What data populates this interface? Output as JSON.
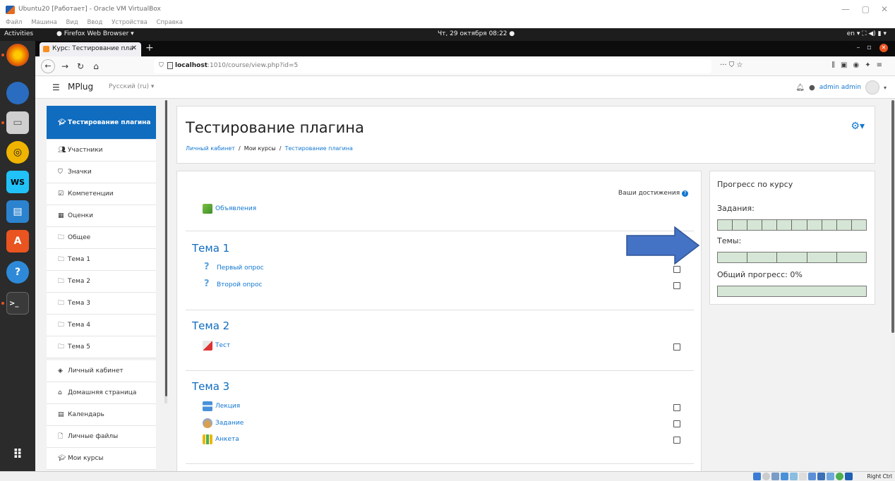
{
  "vbox": {
    "title": "Ubuntu20 [Работает] - Oracle VM VirtualBox",
    "menu": [
      "Файл",
      "Машина",
      "Вид",
      "Ввод",
      "Устройства",
      "Справка"
    ],
    "host_key": "Right Ctrl"
  },
  "gnome": {
    "activities": "Activities",
    "app": "Firefox Web Browser ▾",
    "clock": "Чт, 29 октября  08:22  ●",
    "tray": "en ▾   ⛶  ◀)  ▮ ▾"
  },
  "firefox": {
    "tab_title": "Курс: Тестирование пла",
    "url_host": "localhost",
    "url_path": ":1010/course/view.php?id=5"
  },
  "moodle": {
    "brand": "MPlug",
    "lang": "Русский (ru) ▾",
    "user": "admin admin",
    "course_title": "Тестирование плагина",
    "breadcrumb": [
      "Личный кабинет",
      "Мои курсы",
      "Тестирование плагина"
    ],
    "drawer": [
      {
        "label": "Тестирование плагина",
        "icon": "graduation-cap-icon",
        "active": true
      },
      {
        "label": "Участники",
        "icon": "users-icon"
      },
      {
        "label": "Значки",
        "icon": "shield-icon"
      },
      {
        "label": "Компетенции",
        "icon": "checkbox-icon"
      },
      {
        "label": "Оценки",
        "icon": "table-icon"
      },
      {
        "label": "Общее",
        "icon": "folder-icon"
      },
      {
        "label": "Тема 1",
        "icon": "folder-icon"
      },
      {
        "label": "Тема 2",
        "icon": "folder-icon"
      },
      {
        "label": "Тема 3",
        "icon": "folder-icon"
      },
      {
        "label": "Тема 4",
        "icon": "folder-icon"
      },
      {
        "label": "Тема 5",
        "icon": "folder-icon"
      },
      {
        "label": "Личный кабинет",
        "icon": "dashboard-icon"
      },
      {
        "label": "Домашняя страница",
        "icon": "home-icon"
      },
      {
        "label": "Календарь",
        "icon": "calendar-icon"
      },
      {
        "label": "Личные файлы",
        "icon": "file-icon"
      },
      {
        "label": "Мои курсы",
        "icon": "graduation-cap-icon"
      }
    ],
    "achievements": "Ваши достижения",
    "announcements": "Объявления",
    "sections": [
      {
        "title": "Тема 1",
        "activities": [
          "Первый опрос",
          "Второй опрос"
        ]
      },
      {
        "title": "Тема 2",
        "activities": [
          "Тест"
        ]
      },
      {
        "title": "Тема 3",
        "activities": [
          "Лекция",
          "Задание",
          "Анкета"
        ]
      }
    ],
    "progress": {
      "title": "Прогресс по курсу",
      "tasks_label": "Задания:",
      "tasks_segments": 10,
      "tasks_done": 0,
      "topics_label": "Темы:",
      "topics_segments": 5,
      "topics_done": 0,
      "overall_label": "Общий прогресс: 0%",
      "overall_fraction": 0
    }
  }
}
